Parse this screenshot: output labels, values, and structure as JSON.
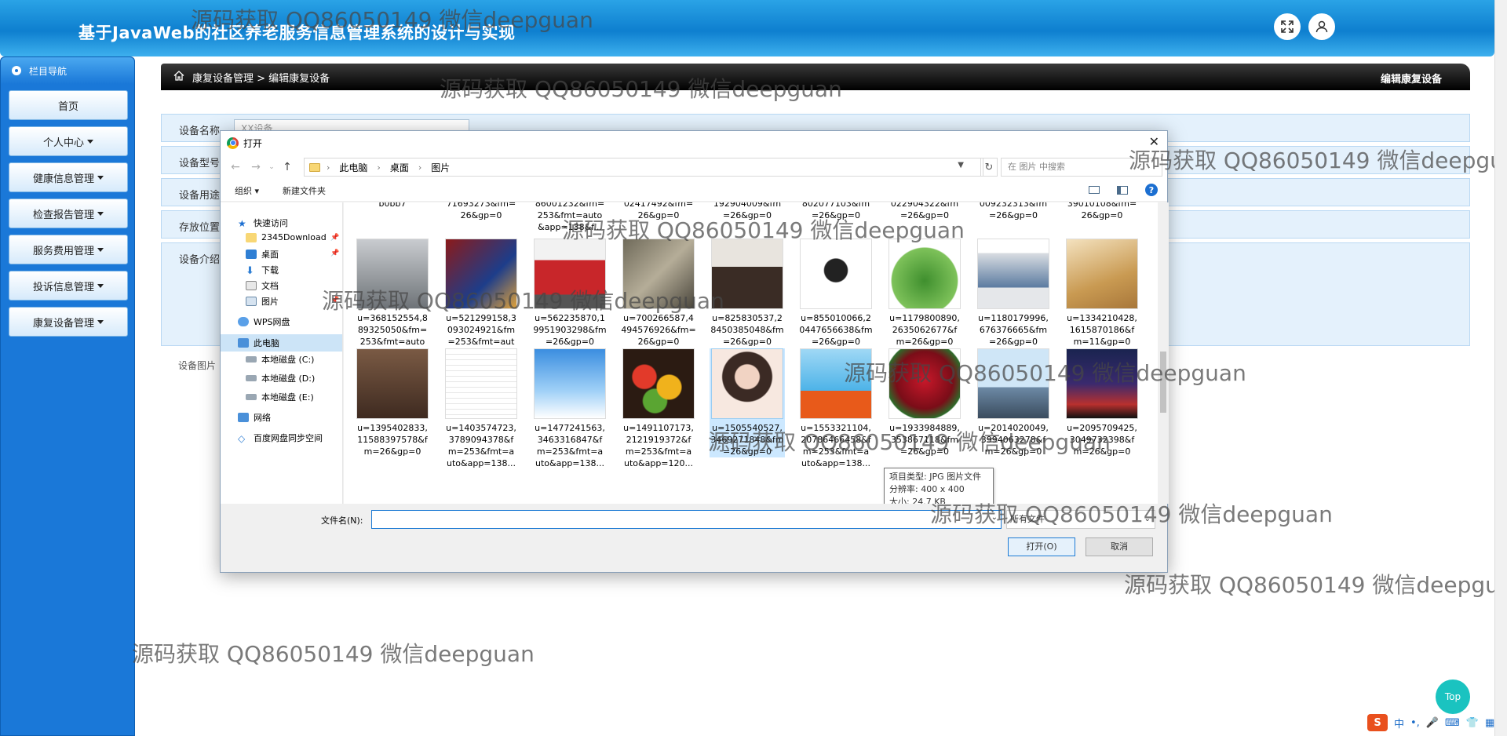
{
  "app": {
    "title": "基于JavaWeb的社区养老服务信息管理系统的设计与实现"
  },
  "sidebar": {
    "header": "栏目导航",
    "items": [
      {
        "label": "首页",
        "dropdown": false
      },
      {
        "label": "个人中心",
        "dropdown": true
      },
      {
        "label": "健康信息管理",
        "dropdown": true
      },
      {
        "label": "检查报告管理",
        "dropdown": true
      },
      {
        "label": "服务费用管理",
        "dropdown": true
      },
      {
        "label": "投诉信息管理",
        "dropdown": true
      },
      {
        "label": "康复设备管理",
        "dropdown": true
      }
    ]
  },
  "breadcrumb": {
    "path": "康复设备管理 > 编辑康复设备",
    "right": "编辑康复设备"
  },
  "form": {
    "name_label": "设备名称",
    "name_placeholder": "XX设备",
    "model_label": "设备型号",
    "usage_label": "设备用途",
    "location_label": "存放位置",
    "intro_label": "设备介绍",
    "image_label": "设备图片"
  },
  "dialog": {
    "title": "打开",
    "path": [
      "此电脑",
      "桌面",
      "图片"
    ],
    "search_placeholder": "在 图片 中搜索",
    "organize": "组织 ▾",
    "new_folder": "新建文件夹",
    "tree": {
      "quick_access": "快速访问",
      "downloads_2345": "2345Download",
      "desktop": "桌面",
      "download": "下载",
      "documents": "文档",
      "pictures": "图片",
      "wps": "WPS网盘",
      "this_pc": "此电脑",
      "disk_c": "本地磁盘 (C:)",
      "disk_d": "本地磁盘 (D:)",
      "disk_e": "本地磁盘 (E:)",
      "network": "网络",
      "baidu": "百度网盘同步空间"
    },
    "partial_row": [
      "b0bb7",
      "71693273&fm=\n26&gp=0",
      "86001232&fm=\n253&fmt=auto\n&app=138&f...",
      "02417492&fm=\n26&gp=0",
      "192904009&fm\n=26&gp=0",
      "802077103&fm\n=26&gp=0",
      "022904322&fm\n=26&gp=0",
      "009232313&fm\n=26&gp=0",
      "39010108&fm=\n26&gp=0"
    ],
    "row1": [
      "u=368152554,8\n89325050&fm=\n253&fmt=auto\n&app=138&f...",
      "u=521299158,3\n093024921&fm\n=253&fmt=aut\no&app=138...",
      "u=562235870,1\n9951903298&fm\n=26&gp=0",
      "u=700266587,4\n494576926&fm=\n26&gp=0",
      "u=825830537,2\n8450385048&fm\n=26&gp=0",
      "u=855010066,2\n0447656638&fm\n=26&gp=0",
      "u=1179800890,\n2635062677&f\nm=26&gp=0",
      "u=1180179996,\n676376665&fm\n=26&gp=0",
      "u=1334210428,\n1615870186&f\nm=11&gp=0"
    ],
    "row2": [
      "u=1395402833,\n11588397578&f\nm=26&gp=0",
      "u=1403574723,\n3789094378&f\nm=253&fmt=a\nuto&app=138...",
      "u=1477241563,\n3463316847&f\nm=253&fmt=a\nuto&app=138...",
      "u=1491107173,\n2121919372&f\nm=253&fmt=a\nuto&app=120...",
      "u=1505540527,\n3469271848&fm\n=26&gp=0",
      "u=1553321104,\n20786466458&f\nm=253&fmt=a\nuto&app=138...",
      "u=1933984889,\n353867118&fm\n=26&gp=0",
      "u=2014020049,\n3994063278&f\nm=26&gp=0",
      "u=2095709425,\n3049732398&f\nm=26&gp=0"
    ],
    "tooltip": [
      "项目类型: JPG 图片文件",
      "分辨率: 400 x 400",
      "大小: 24.7 KB"
    ],
    "filename_label": "文件名(N):",
    "filter": "所有文件",
    "open_button": "打开(O)",
    "cancel_button": "取消"
  },
  "watermark": "源码获取 QQ86050149 微信deepguan",
  "fab_top": "Top",
  "ime": {
    "logo": "S",
    "lang": "中"
  },
  "colors": {
    "header_blue": "#1a8ee0",
    "sidebar_blue": "#1a78d8",
    "form_row_bg": "#e4f1fc",
    "accent_teal": "#1ac3c0"
  }
}
